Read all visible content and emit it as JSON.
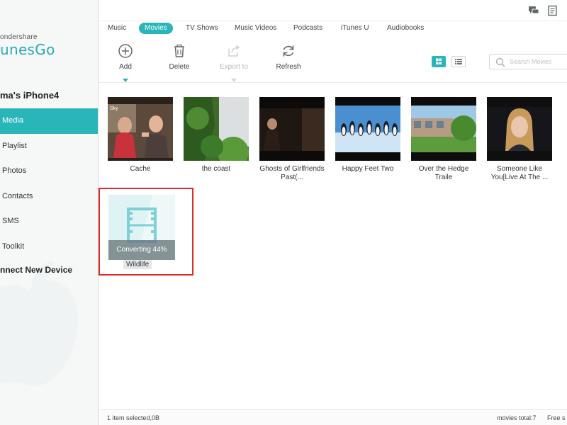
{
  "app": {
    "brand_top": "ondershare",
    "brand_main": "unesGo"
  },
  "sidebar": {
    "device_name": "ma's iPhone4",
    "items": [
      {
        "label": "Media",
        "active": true
      },
      {
        "label": "Playlist",
        "active": false
      },
      {
        "label": "Photos",
        "active": false
      },
      {
        "label": "Contacts",
        "active": false
      },
      {
        "label": "SMS",
        "active": false
      },
      {
        "label": "Toolkit",
        "active": false
      }
    ],
    "connect_label": "nnect New Device"
  },
  "tabs": [
    {
      "label": "Music",
      "active": false
    },
    {
      "label": "Movies",
      "active": true
    },
    {
      "label": "TV Shows",
      "active": false
    },
    {
      "label": "Music Videos",
      "active": false
    },
    {
      "label": "Podcasts",
      "active": false
    },
    {
      "label": "iTunes U",
      "active": false
    },
    {
      "label": "Audiobooks",
      "active": false
    }
  ],
  "toolbar": {
    "add": "Add",
    "delete": "Delete",
    "export": "Export to",
    "refresh": "Refresh",
    "search_placeholder": "Search Movies"
  },
  "media": [
    {
      "title": "Cache",
      "icon": "movie-thumbnail"
    },
    {
      "title": "the coast",
      "icon": "movie-thumbnail"
    },
    {
      "title": "Ghosts of Girlfriends Past(...",
      "icon": "movie-thumbnail"
    },
    {
      "title": "Happy Feet Two",
      "icon": "movie-thumbnail"
    },
    {
      "title": "Over the Hedge Traile",
      "icon": "movie-thumbnail"
    },
    {
      "title": "Someone Like You[Live At The ...",
      "icon": "movie-thumbnail"
    }
  ],
  "converting": {
    "title": "Wildlife",
    "status": "Converting 44%",
    "progress_percent": 44,
    "icon": "film-strip-icon"
  },
  "status": {
    "left": "1 item selected,0B",
    "right": "movies total:7",
    "free": "Free s"
  },
  "colors": {
    "accent": "#2ab5b9",
    "highlight_border": "#e02828"
  }
}
